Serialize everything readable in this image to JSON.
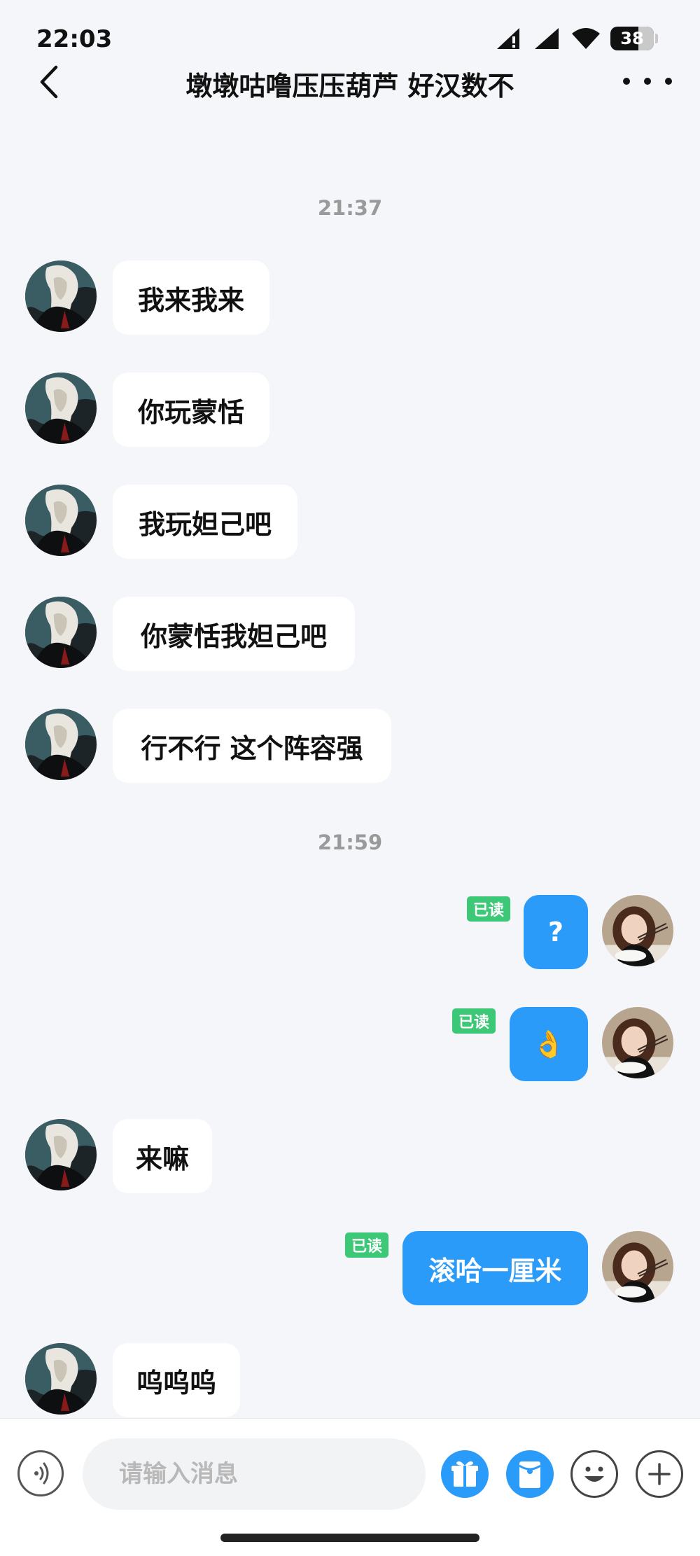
{
  "status_bar": {
    "time": "22:03",
    "battery": "38",
    "icons": [
      "signal-alert-icon",
      "signal-icon",
      "wifi-icon",
      "battery-icon"
    ]
  },
  "header": {
    "title": "墩墩咕噜压压葫芦 好汉数不",
    "back_icon": "chevron-left-icon",
    "more_icon": "more-dots-icon"
  },
  "timestamps": [
    "21:37",
    "21:59"
  ],
  "messages": [
    {
      "side": "left",
      "text": "我来我来"
    },
    {
      "side": "left",
      "text": "你玩蒙恬"
    },
    {
      "side": "left",
      "text": "我玩妲己吧"
    },
    {
      "side": "left",
      "text": "你蒙恬我妲己吧"
    },
    {
      "side": "left",
      "text": "行不行 这个阵容强"
    },
    {
      "side": "right",
      "text": "?",
      "status": "已读"
    },
    {
      "side": "right",
      "text": "👌",
      "status": "已读"
    },
    {
      "side": "left",
      "text": "来嘛"
    },
    {
      "side": "right",
      "text": "滚哈一厘米",
      "status": "已读"
    },
    {
      "side": "left",
      "text": "呜呜呜"
    }
  ],
  "input_bar": {
    "placeholder": "请输入消息",
    "buttons": [
      "voice-icon",
      "gift-icon",
      "red-packet-icon",
      "emoji-icon",
      "plus-icon"
    ]
  },
  "colors": {
    "background": "#f4f6f9",
    "own_bubble": "#2b9bfa",
    "read_badge": "#3dc878",
    "timestamp_text": "#9a9a9a"
  }
}
